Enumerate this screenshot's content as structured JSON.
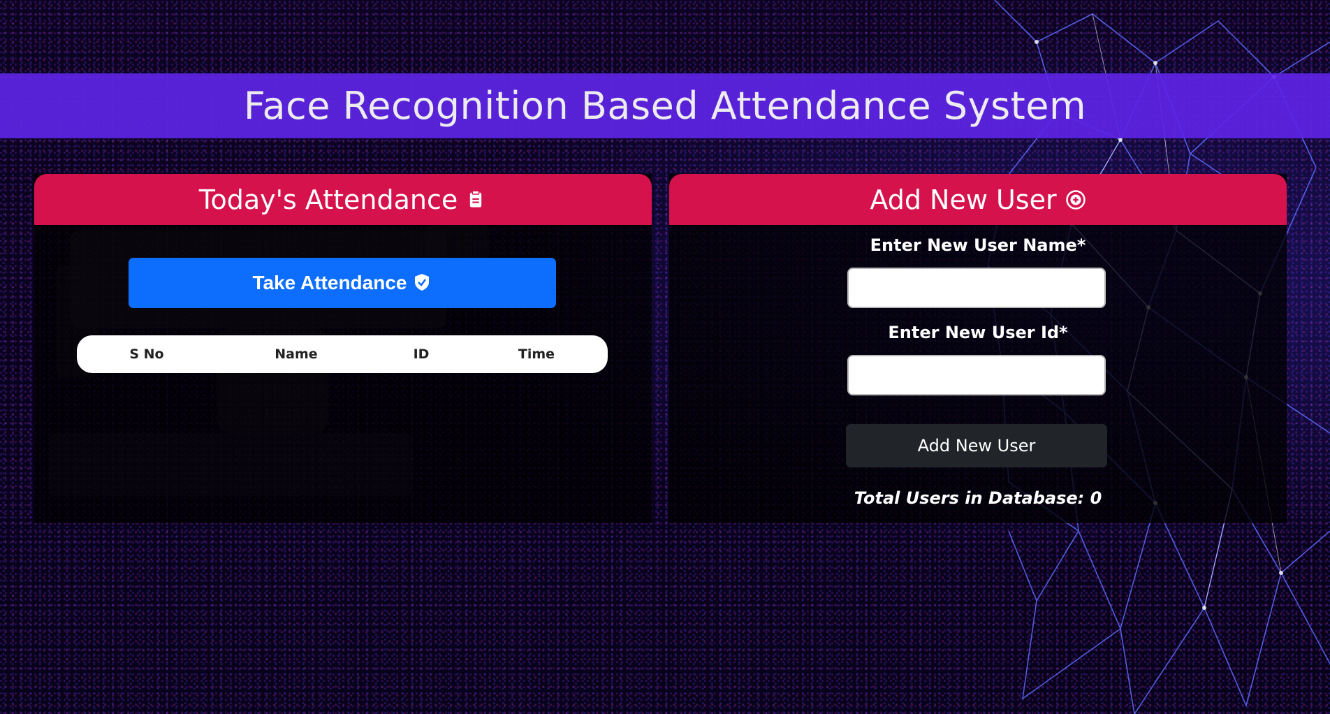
{
  "header": {
    "title": "Face Recognition Based Attendance System"
  },
  "attendance_panel": {
    "title": "Today's Attendance",
    "icon": "clipboard-icon",
    "take_button_label": "Take Attendance",
    "take_button_icon": "shield-check-icon",
    "table": {
      "columns": [
        "S No",
        "Name",
        "ID",
        "Time"
      ],
      "rows": []
    }
  },
  "add_user_panel": {
    "title": "Add New User",
    "icon": "plus-circle-icon",
    "name_label": "Enter New User Name*",
    "name_value": "",
    "id_label": "Enter New User Id*",
    "id_value": "",
    "submit_label": "Add New User",
    "total_users_text": "Total Users in Database: 0"
  },
  "colors": {
    "header_bg": "#5e24e6",
    "panel_header_bg": "#d6124c",
    "primary_button": "#0d6efd",
    "dark_button": "#212529"
  }
}
